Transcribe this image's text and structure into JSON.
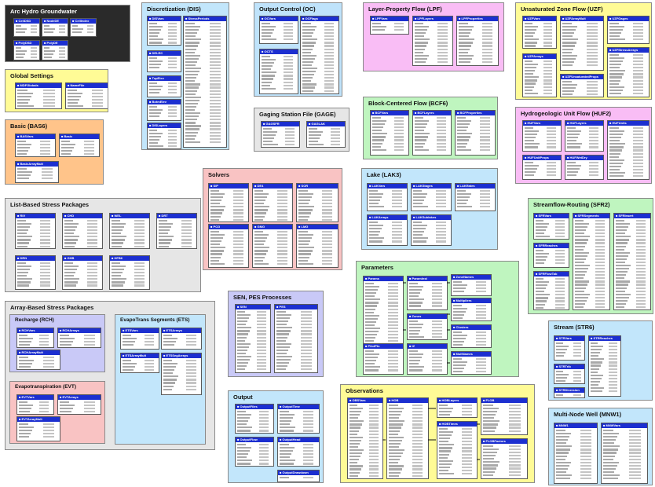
{
  "title": "Arc Hydro Groundwater",
  "packages": [
    {
      "id": "arc",
      "title": "Arc Hydro Groundwater",
      "color": "#2a2a2a",
      "tables": [
        "CellDSD",
        "NodeDE",
        "CellIndex",
        "PolyDSD",
        "PolyDE"
      ]
    },
    {
      "id": "global",
      "title": "Global Settings",
      "color": "#fffb96",
      "tables": [
        "MDFGlobals",
        "NameFile"
      ]
    },
    {
      "id": "bas",
      "title": "Basic (BAS6)",
      "color": "#ffc48a",
      "tables": [
        "BASVars",
        "Basic",
        "BasicArrayMult"
      ]
    },
    {
      "id": "dis",
      "title": "Discretization (DIS)",
      "color": "#c2e6fb",
      "tables": [
        "DISVars",
        "StressPeriods",
        "DELRC",
        "TopElev",
        "BotmElev",
        "DISLayers"
      ]
    },
    {
      "id": "oc",
      "title": "Output Control (OC)",
      "color": "#bfe3fb",
      "tables": [
        "OCVars",
        "OCFlags",
        "OCTS"
      ]
    },
    {
      "id": "gage",
      "title": "Gaging Station File (GAGE)",
      "color": "#e6e6e6",
      "tables": [
        "GAGSFR",
        "GAGLAK"
      ]
    },
    {
      "id": "lpf",
      "title": "Layer-Property Flow (LPF)",
      "color": "#f9bdf5",
      "tables": [
        "LPFVars",
        "LPFLayers",
        "LPFProperties"
      ]
    },
    {
      "id": "bcf",
      "title": "Block-Centered Flow (BCF6)",
      "color": "#bff5bf",
      "tables": [
        "BCFVars",
        "BCFLayers",
        "BCFProperties"
      ]
    },
    {
      "id": "uzf",
      "title": "Unsaturated Zone Flow (UZF)",
      "color": "#fffb96",
      "tables": [
        "UZFVars",
        "UZFArrayMult",
        "UZFGages",
        "UZFArrays",
        "UZFStressArrays",
        "UZFUnsaturatedProps"
      ]
    },
    {
      "id": "huf",
      "title": "Hydrogeologic Unit Flow (HUF2)",
      "color": "#f9bdf5",
      "tables": [
        "HUFVars",
        "HUFLayers",
        "HUFUnits",
        "HUFWetDry",
        "HUFUnitProps"
      ]
    },
    {
      "id": "solvers",
      "title": "Solvers",
      "color": "#f9c3c3",
      "tables": [
        "SIP",
        "DE4",
        "SOR",
        "PCG",
        "GMG",
        "LMG"
      ]
    },
    {
      "id": "lak",
      "title": "Lake (LAK3)",
      "color": "#c2e6fb",
      "tables": [
        "LAKVars",
        "LAKStages",
        "LAKRates",
        "LAKArrays",
        "LAKSublakes"
      ]
    },
    {
      "id": "sfr",
      "title": "Streamflow-Routing (SFR2)",
      "color": "#bff5bf",
      "tables": [
        "SFRVars",
        "SFRSegments",
        "SFRInsert",
        "SFRReaches",
        "SFRFlowTab"
      ]
    },
    {
      "id": "list",
      "title": "List-Based Stress Packages",
      "color": "#e6e6e6",
      "tables": [
        "RIV",
        "CHD",
        "WEL",
        "DRT",
        "DRN",
        "GHB",
        "HFB6"
      ]
    },
    {
      "id": "params",
      "title": "Parameters",
      "color": "#bff5bf",
      "tables": [
        "Params",
        "ParamInst",
        "ZoneNames",
        "Zones",
        "Multipliers",
        "Clusters",
        "MultNames",
        "IZ",
        "PilotPts"
      ]
    },
    {
      "id": "array",
      "title": "Array-Based Stress Packages",
      "color": "#e6e6e6",
      "tables": []
    },
    {
      "id": "rch",
      "title": "Recharge (RCH)",
      "color": "#c9c9f7",
      "tables": [
        "RCHVars",
        "RCHArrays",
        "RCHArrayMult"
      ]
    },
    {
      "id": "ets",
      "title": "EvapoTrans Segments (ETS)",
      "color": "#c2e6fb",
      "tables": [
        "ETSVars",
        "ETSArrays",
        "ETSArrayMult",
        "ETSSegArrays"
      ]
    },
    {
      "id": "evt",
      "title": "Evapotranspiration (EVT)",
      "color": "#f9c3c3",
      "tables": [
        "EVTVars",
        "EVTArrays",
        "EVTArrayMult"
      ]
    },
    {
      "id": "sen",
      "title": "SEN, PES Processes",
      "color": "#c9c9f7",
      "tables": [
        "SEN",
        "PES"
      ]
    },
    {
      "id": "output",
      "title": "Output",
      "color": "#c2e6fb",
      "tables": [
        "OutputFiles",
        "OutputTime",
        "OutputFlow",
        "OutputHead",
        "OutputDrawdown"
      ]
    },
    {
      "id": "obs",
      "title": "Observations",
      "color": "#fffb96",
      "tables": [
        "OBSVars",
        "HOB",
        "HOBLayers",
        "FLOB",
        "HOBTimes",
        "FLOBFactors"
      ]
    },
    {
      "id": "str",
      "title": "Stream (STR6)",
      "color": "#c2e6fb",
      "tables": [
        "STRVars",
        "STRReaches",
        "STRTrib",
        "STRDiversion"
      ]
    },
    {
      "id": "mnw",
      "title": "Multi-Node Well (MNW1)",
      "color": "#c2e6fb",
      "tables": [
        "MNW1",
        "MNWVars"
      ]
    }
  ]
}
